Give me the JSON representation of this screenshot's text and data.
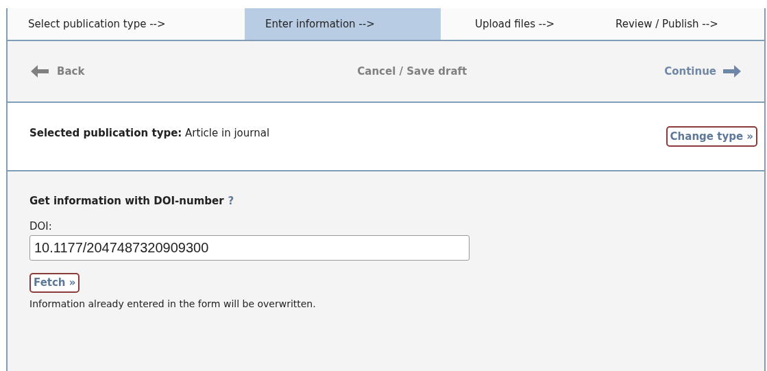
{
  "steps": [
    {
      "label": "Select publication type -->",
      "selected": false
    },
    {
      "label": "Enter information -->",
      "selected": true
    },
    {
      "label": "Upload files -->",
      "selected": false
    },
    {
      "label": "Review / Publish -->",
      "selected": false
    }
  ],
  "nav": {
    "back": "Back",
    "cancel": "Cancel / Save draft",
    "continue": "Continue"
  },
  "selected_type": {
    "label": "Selected publication type:",
    "value": "Article in journal",
    "button": "Change type »"
  },
  "doi": {
    "heading": "Get information with DOI-number",
    "help": "?",
    "field_label": "DOI:",
    "value": "10.1177/2047487320909300",
    "button": "Fetch »",
    "note": "Information already entered in the form will be overwritten."
  }
}
